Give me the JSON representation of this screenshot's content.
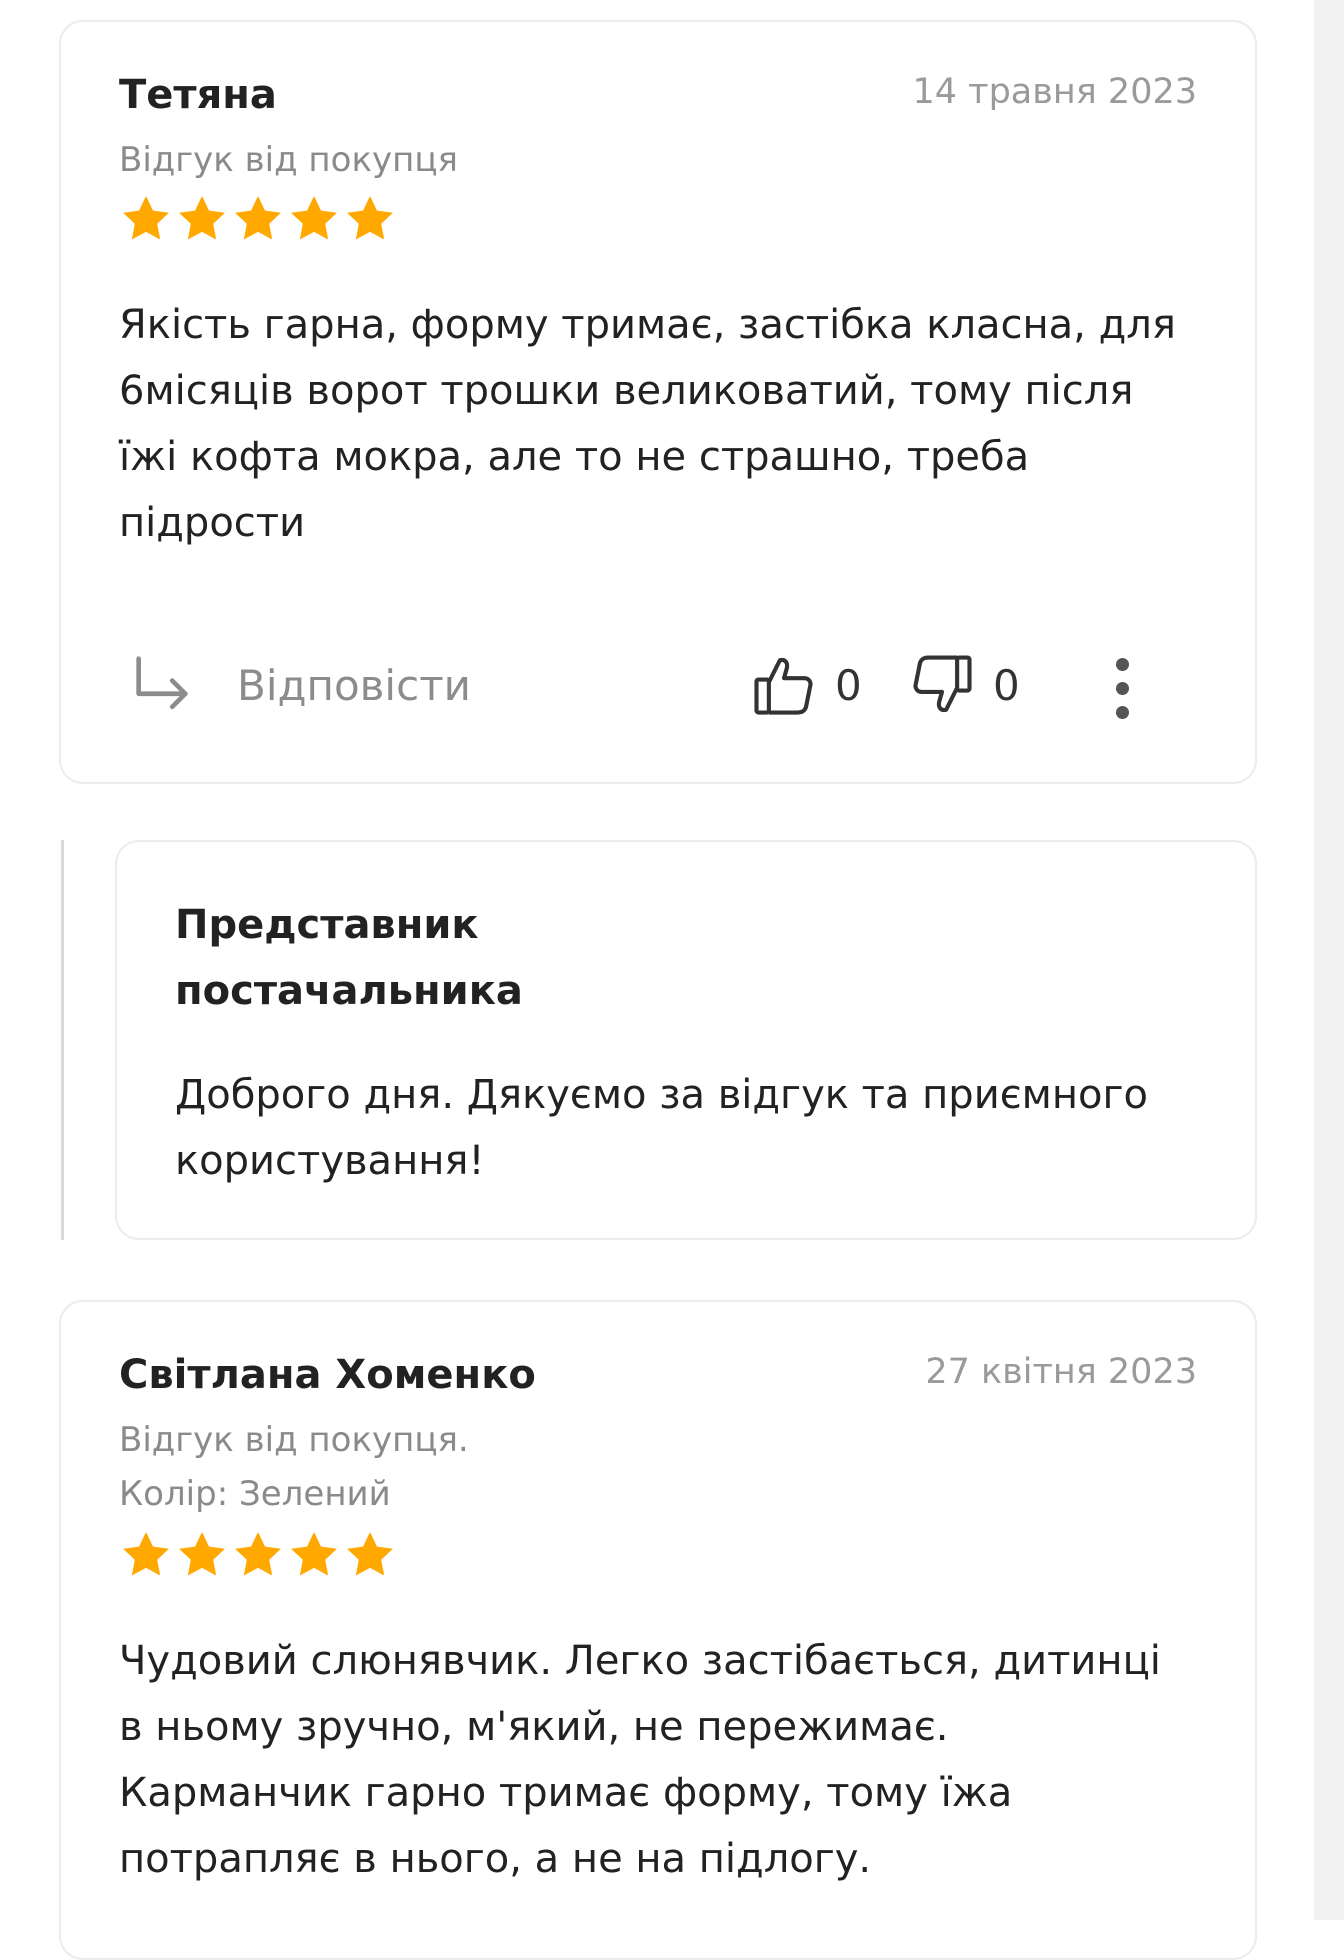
{
  "reviews": [
    {
      "name": "Тетяна",
      "date": "14 травня 2023",
      "meta": [
        "Відгук від покупця"
      ],
      "rating": 5,
      "text": "Якість гарна, форму тримає, застібка класна, для 6місяців ворот трошки великоватий, тому після їжі кофта мокра, але то не страшно, треба підрости",
      "actions": {
        "reply_label": "Відповісти",
        "likes": "0",
        "dislikes": "0"
      }
    },
    {
      "name": "Світлана Хоменко",
      "date": "27 квітня 2023",
      "meta": [
        "Відгук від покупця.",
        "Колір: Зелений"
      ],
      "rating": 5,
      "text": "Чудовий слюнявчик. Легко застібається, дитинці в ньому зручно, м'який, не пережимає. Карманчик гарно тримає форму, тому їжа потрапляє в нього, а не на підлогу."
    }
  ],
  "seller_reply": {
    "author": "Представник постачальника",
    "text": "Доброго дня. Дякуємо за відгук та приємного користування!"
  },
  "colors": {
    "star": "#ffa900",
    "card_border": "#ececec",
    "muted_text": "#8a8a8a"
  },
  "icons": {
    "reply": "reply-arrow-icon",
    "like": "thumbs-up-icon",
    "dislike": "thumbs-down-icon",
    "more": "more-vertical-icon",
    "star": "star-icon"
  }
}
